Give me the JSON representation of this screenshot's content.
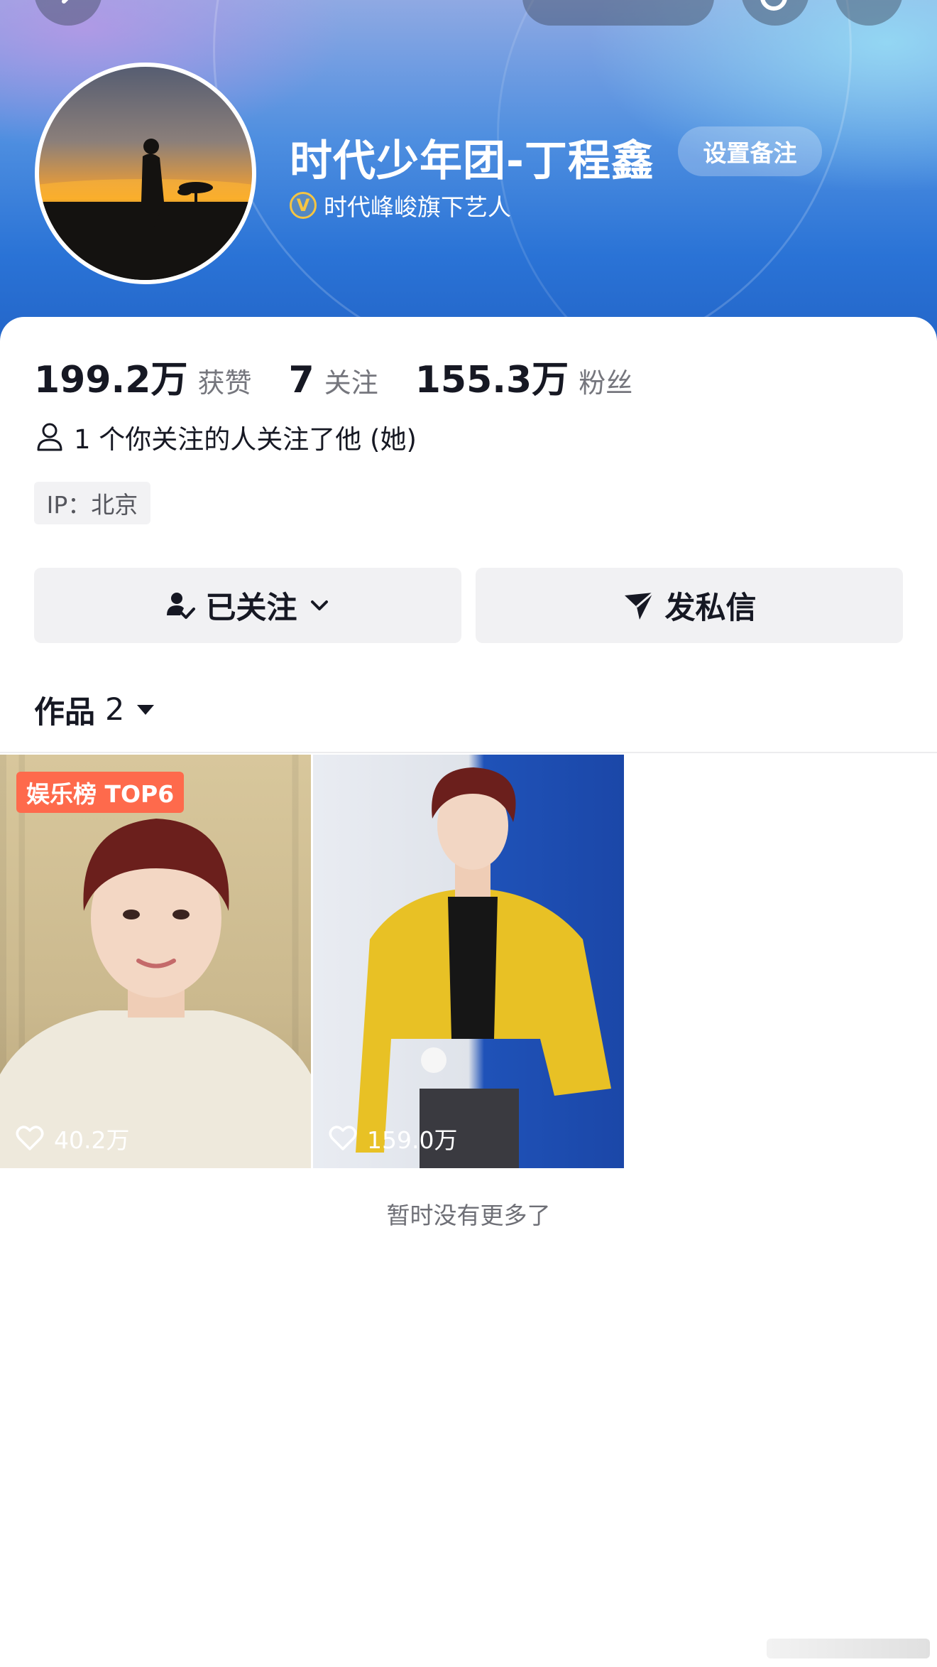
{
  "profile": {
    "name": "时代少年团-丁程鑫",
    "remark_button": "设置备注",
    "verification": "时代峰峻旗下艺人",
    "verified_icon": "v-badge-icon"
  },
  "stats": [
    {
      "value": "199.2万",
      "label": "获赞"
    },
    {
      "value": "7",
      "label": "关注"
    },
    {
      "value": "155.3万",
      "label": "粉丝"
    }
  ],
  "mutual_follow": "1 个你关注的人关注了他 (她)",
  "ip_location": "IP：北京",
  "actions": {
    "following_label": "已关注",
    "message_label": "发私信"
  },
  "works": {
    "label": "作品",
    "count": "2"
  },
  "videos": [
    {
      "badge": "娱乐榜 TOP6",
      "likes": "40.2万"
    },
    {
      "likes": "159.0万"
    }
  ],
  "footer_text": "暂时没有更多了",
  "colors": {
    "accent_badge": "#fe6a4c",
    "verify_gold": "#f5c542",
    "banner_blue": "#2a73d6"
  }
}
